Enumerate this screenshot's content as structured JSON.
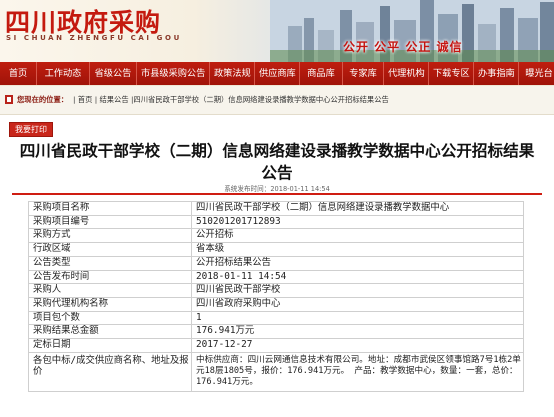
{
  "header": {
    "brand_zh": "四川政府采购",
    "brand_en": "SI CHUAN ZHENGFU CAI GOU",
    "slogan": "公开 公平 公正 诚信"
  },
  "nav": {
    "items": [
      "首页",
      "工作动态",
      "省级公告",
      "市县级采购公告",
      "政策法规",
      "供应商库",
      "商品库",
      "专家库",
      "代理机构",
      "下载专区",
      "办事指南",
      "曝光台"
    ]
  },
  "breadcrumb": {
    "label": "您现在的位置：",
    "path": "| 首页 | 结果公告 |四川省民政干部学校（二期）信息网络建设录播教学数据中心公开招标结果公告"
  },
  "print_label": "我要打印",
  "article": {
    "title": "四川省民政干部学校（二期）信息网络建设录播教学数据中心公开招标结果公告",
    "publish_time": "系统发布时间：2018-01-11 14:54"
  },
  "info_table": [
    {
      "key": "采购项目名称",
      "value": "四川省民政干部学校（二期）信息网络建设录播教学数据中心"
    },
    {
      "key": "采购项目编号",
      "value": "510201201712893"
    },
    {
      "key": "采购方式",
      "value": "公开招标"
    },
    {
      "key": "行政区域",
      "value": "省本级"
    },
    {
      "key": "公告类型",
      "value": "公开招标结果公告"
    },
    {
      "key": "公告发布时间",
      "value": "2018-01-11 14:54"
    },
    {
      "key": "采购人",
      "value": "四川省民政干部学校"
    },
    {
      "key": "采购代理机构名称",
      "value": "四川省政府采购中心"
    },
    {
      "key": "项目包个数",
      "value": "1"
    },
    {
      "key": "采购结果总金额",
      "value": "176.941万元"
    },
    {
      "key": "定标日期",
      "value": "2017-12-27"
    },
    {
      "key": "各包中标/成交供应商名称、地址及报价",
      "value": "中标供应商：四川云网通信息技术有限公司。地址：成都市武侯区领事馆路7号1栋2单元18层1805号，报价：176.941万元。 产品：教学数据中心，数量：一套，总价：176.941万元。"
    }
  ]
}
